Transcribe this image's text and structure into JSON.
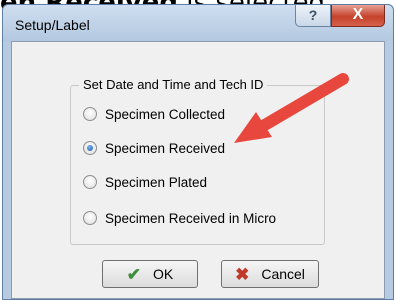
{
  "caption": {
    "bold": "en Received",
    "rest": " is selected."
  },
  "window": {
    "title": "Setup/Label",
    "help_glyph": "?",
    "close_glyph": "X"
  },
  "group": {
    "legend": "Set Date and Time and Tech ID",
    "options": [
      {
        "label": "Specimen Collected",
        "selected": false
      },
      {
        "label": "Specimen Received",
        "selected": true
      },
      {
        "label": "Specimen Plated",
        "selected": false
      },
      {
        "label": "Specimen Received in Micro",
        "selected": false
      }
    ]
  },
  "buttons": {
    "ok_label": "OK",
    "cancel_label": "Cancel"
  },
  "annotation": {
    "arrow_color": "#e8473e"
  }
}
